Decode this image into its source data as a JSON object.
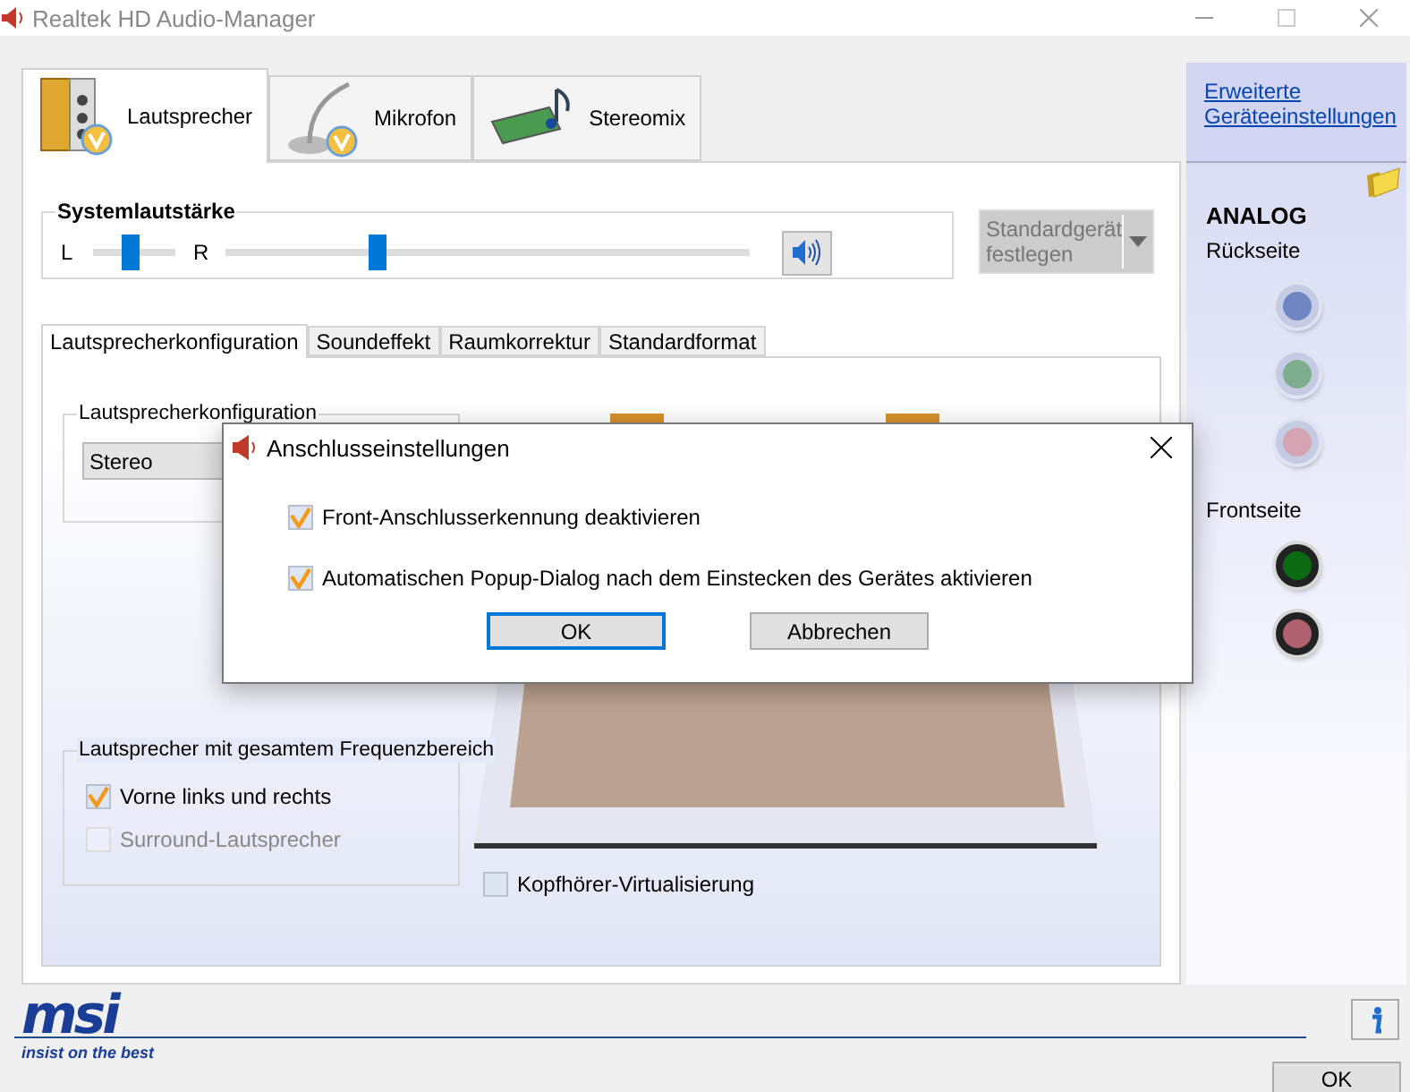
{
  "window": {
    "title": "Realtek HD Audio-Manager"
  },
  "device_tabs": [
    {
      "label": "Lautsprecher",
      "kind": "speakers",
      "selected": true,
      "is_default": true
    },
    {
      "label": "Mikrofon",
      "kind": "microphone",
      "selected": false,
      "is_default": true
    },
    {
      "label": "Stereomix",
      "kind": "soundcard",
      "selected": false,
      "is_default": false
    }
  ],
  "volume": {
    "label": "Systemlautstärke",
    "left_label": "L",
    "right_label": "R",
    "balance": {
      "level": 0.46
    },
    "master": {
      "level": 0.29
    },
    "muted": false
  },
  "default_device_button": {
    "label": "Standardgerät festlegen",
    "disabled": true
  },
  "sub_tabs": [
    {
      "label": "Lautsprecherkonfiguration",
      "selected": true
    },
    {
      "label": "Soundeffekt",
      "selected": false
    },
    {
      "label": "Raumkorrektur",
      "selected": false
    },
    {
      "label": "Standardformat",
      "selected": false
    }
  ],
  "speaker_config": {
    "label": "Lautsprecherkonfiguration",
    "value": "Stereo"
  },
  "fullrange": {
    "label": "Lautsprecher mit gesamtem Frequenzbereich",
    "options": [
      {
        "label": "Vorne links und rechts",
        "checked": true,
        "disabled": false
      },
      {
        "label": "Surround-Lautsprecher",
        "checked": false,
        "disabled": true
      }
    ]
  },
  "headphone_virtualization": {
    "label": "Kopfhörer-Virtualisierung",
    "checked": false
  },
  "side_panel": {
    "link": "Erweiterte Geräteeinstellungen",
    "heading": "ANALOG",
    "groups": [
      {
        "label": "Rückseite",
        "jacks": [
          {
            "color": "#6f86c4",
            "plugged": false
          },
          {
            "color": "#7fae8f",
            "plugged": false
          },
          {
            "color": "#d6a3b2",
            "plugged": false
          }
        ]
      },
      {
        "label": "Frontseite",
        "jacks": [
          {
            "color": "#0b6a12",
            "plugged": true
          },
          {
            "color": "#b0606e",
            "plugged": true
          }
        ]
      }
    ]
  },
  "logo": {
    "brand": "msi",
    "slogan": "insist on the best"
  },
  "ok_button": "OK",
  "dialog": {
    "title": "Anschlusseinstellungen",
    "options": [
      {
        "label": "Front-Anschlusserkennung deaktivieren",
        "checked": true
      },
      {
        "label": "Automatischen Popup-Dialog nach dem Einstecken des Gerätes aktivieren",
        "checked": true
      }
    ],
    "buttons": [
      {
        "label": "OK",
        "focused": true
      },
      {
        "label": "Abbrechen",
        "focused": false
      }
    ]
  }
}
